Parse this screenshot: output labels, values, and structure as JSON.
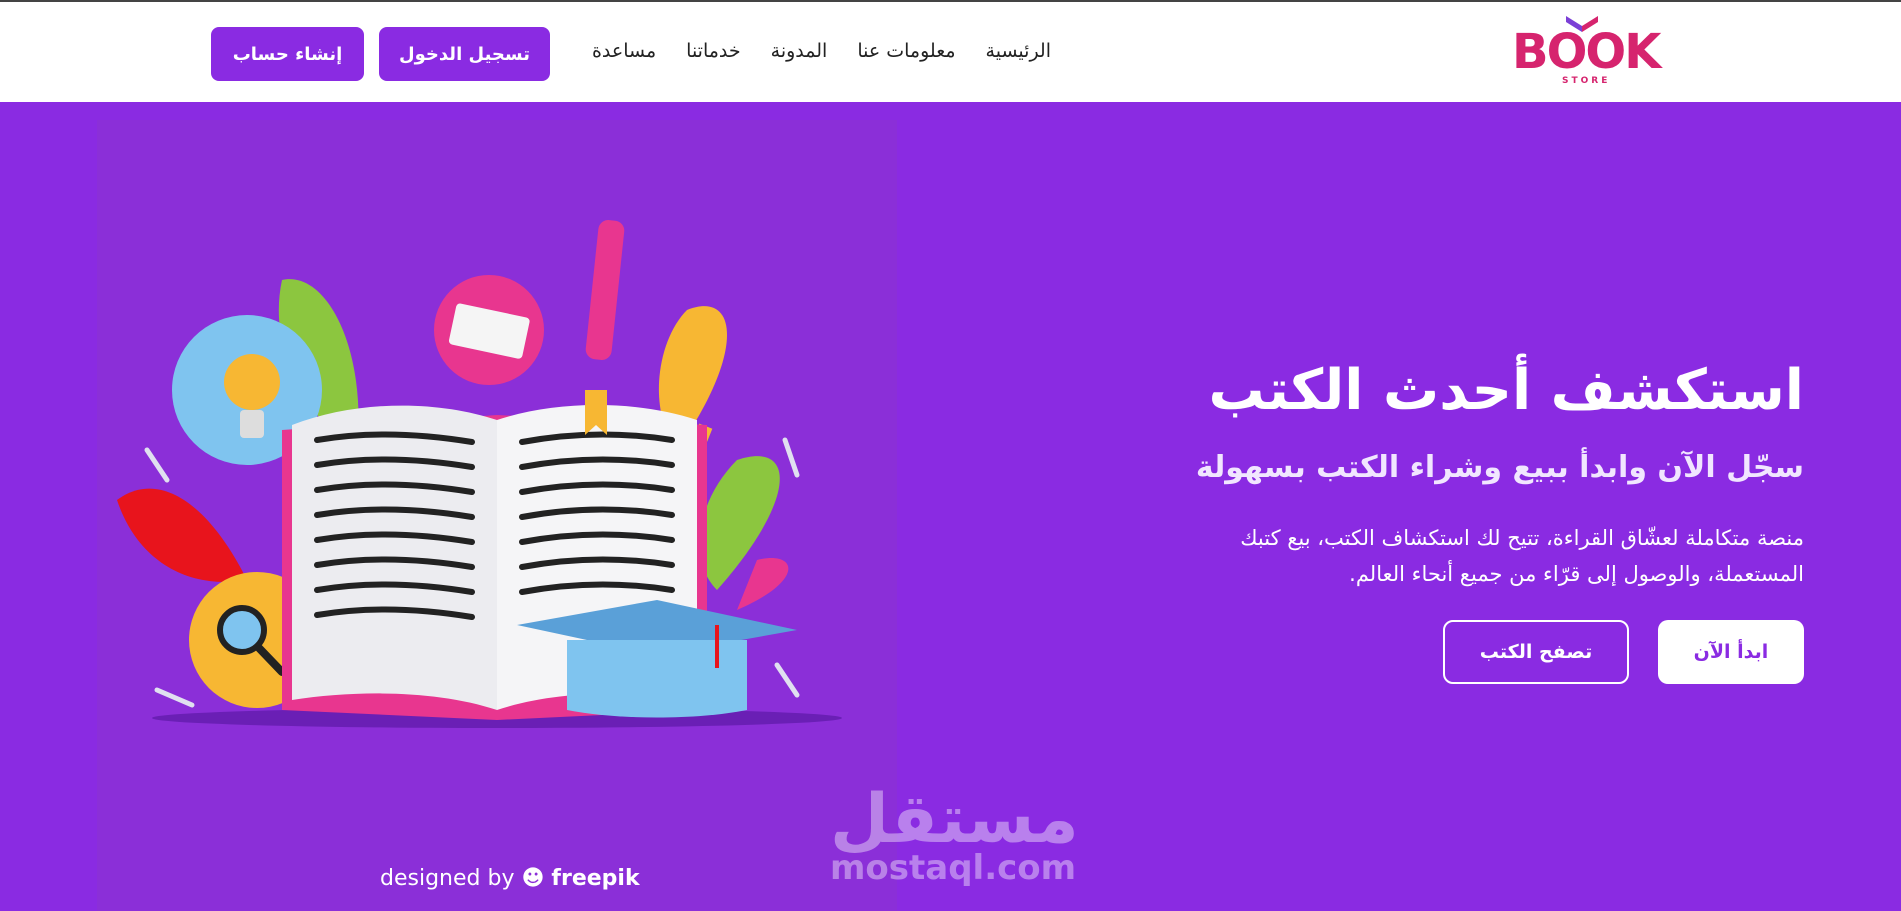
{
  "brand": {
    "logo_word": "BOOK",
    "logo_sub": "STORE",
    "color": "#d6246e"
  },
  "nav": {
    "items": [
      "الرئيسية",
      "معلومات عنا",
      "المدونة",
      "خدماتنا",
      "مساعدة"
    ],
    "login_label": "تسجيل الدخول",
    "signup_label": "إنشاء حساب"
  },
  "hero": {
    "title": "استكشف أحدث الكتب",
    "subtitle": "سجّل الآن وابدأ ببيع وشراء الكتب بسهولة",
    "description": "منصة متكاملة لعشّاق القراءة، تتيح لك استكشاف الكتب، بيع كتبك المستعملة، والوصول إلى قرّاء من جميع أنحاء العالم.",
    "start_label": "ابدأ الآن",
    "browse_label": "تصفح الكتب",
    "credit_prefix": "designed by",
    "credit_brand": "freepik"
  },
  "watermark": {
    "arabic": "مستقل",
    "latin": "mostaql.com"
  },
  "colors": {
    "accent": "#8a2be2",
    "header_bg": "#ffffff"
  }
}
